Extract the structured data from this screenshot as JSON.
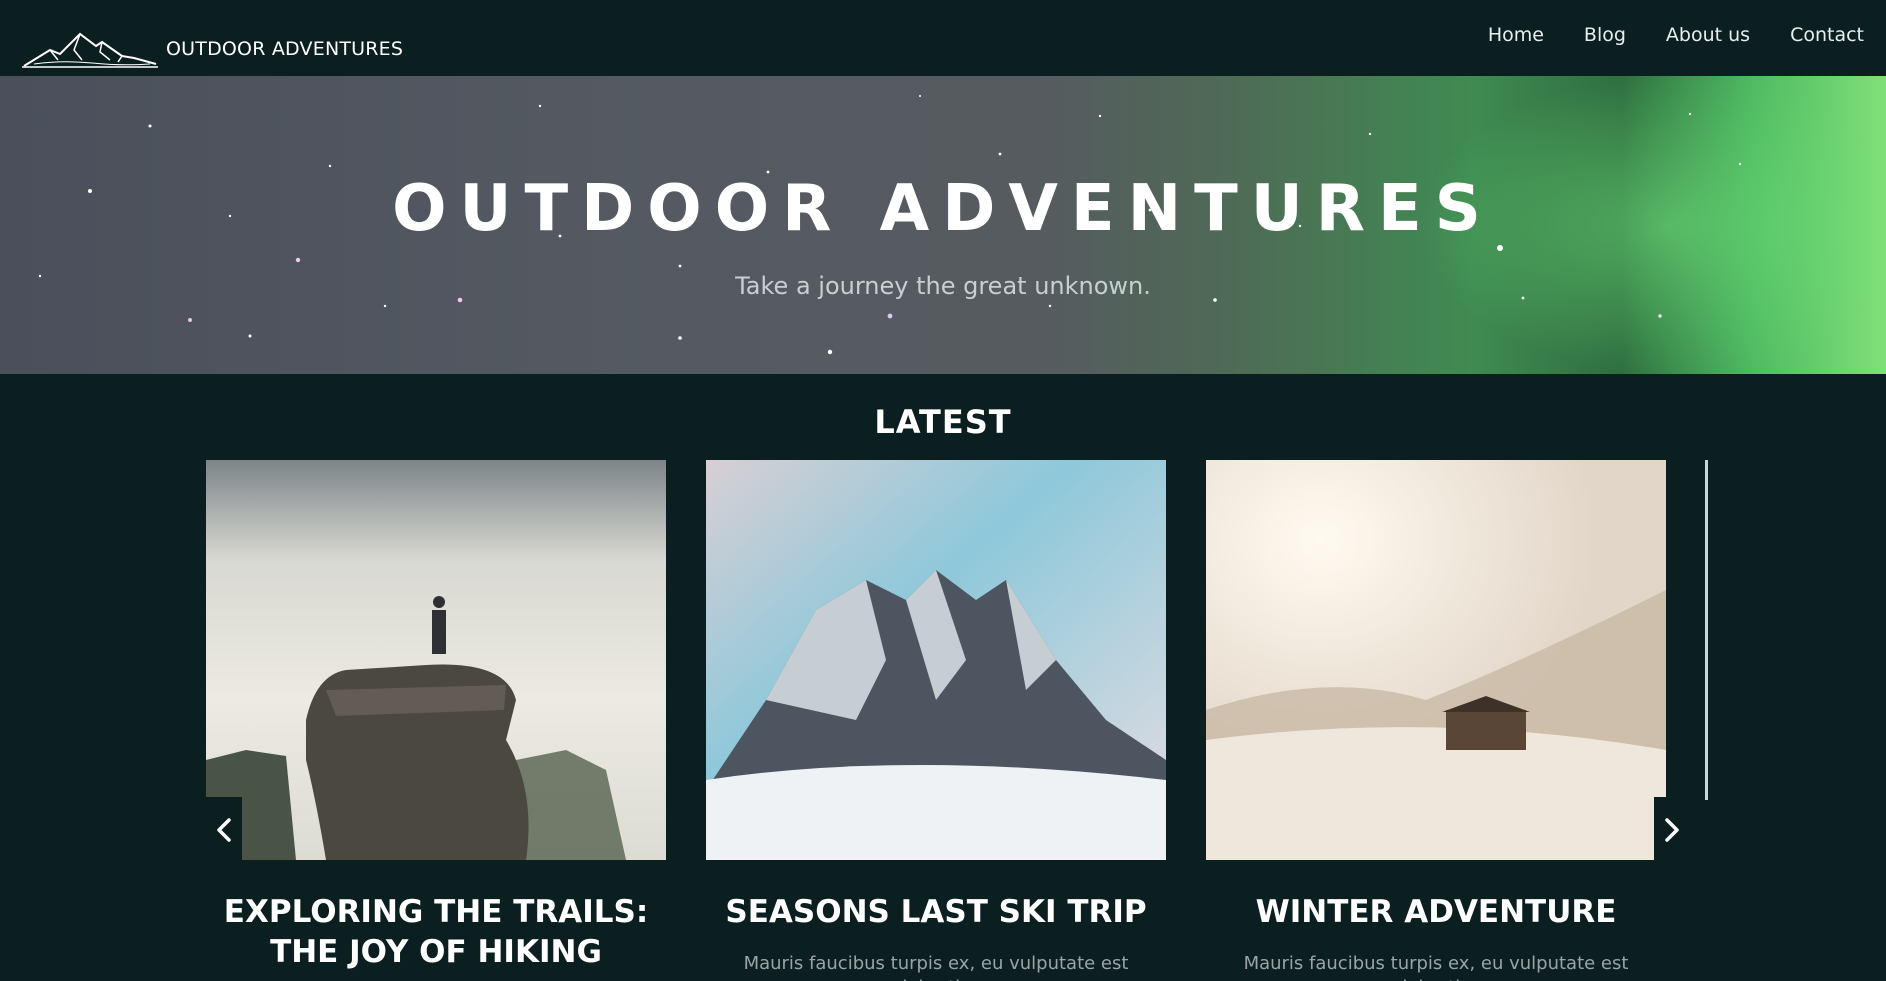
{
  "header": {
    "logo_text": "OUTDOOR ADVENTURES",
    "nav": [
      "Home",
      "Blog",
      "About us",
      "Contact"
    ]
  },
  "hero": {
    "title": "OUTDOOR ADVENTURES",
    "subtitle": "Take a journey the great unknown."
  },
  "latest": {
    "heading": "LATEST",
    "cards": [
      {
        "title": "EXPLORING THE TRAILS: THE JOY OF HIKING",
        "excerpt": ""
      },
      {
        "title": "SEASONS LAST SKI TRIP",
        "excerpt": "Mauris faucibus turpis ex, eu vulputate est lobortis"
      },
      {
        "title": "WINTER ADVENTURE",
        "excerpt": "Mauris faucibus turpis ex, eu vulputate est lobortis"
      }
    ]
  },
  "icons": {
    "prev": "chevron-left-icon",
    "next": "chevron-right-icon",
    "logo": "mountain-logo-icon"
  },
  "colors": {
    "background": "#0c1f20",
    "text": "#ffffff",
    "muted_text": "#9aa4a6",
    "aurora_green": "#4fbb62"
  }
}
